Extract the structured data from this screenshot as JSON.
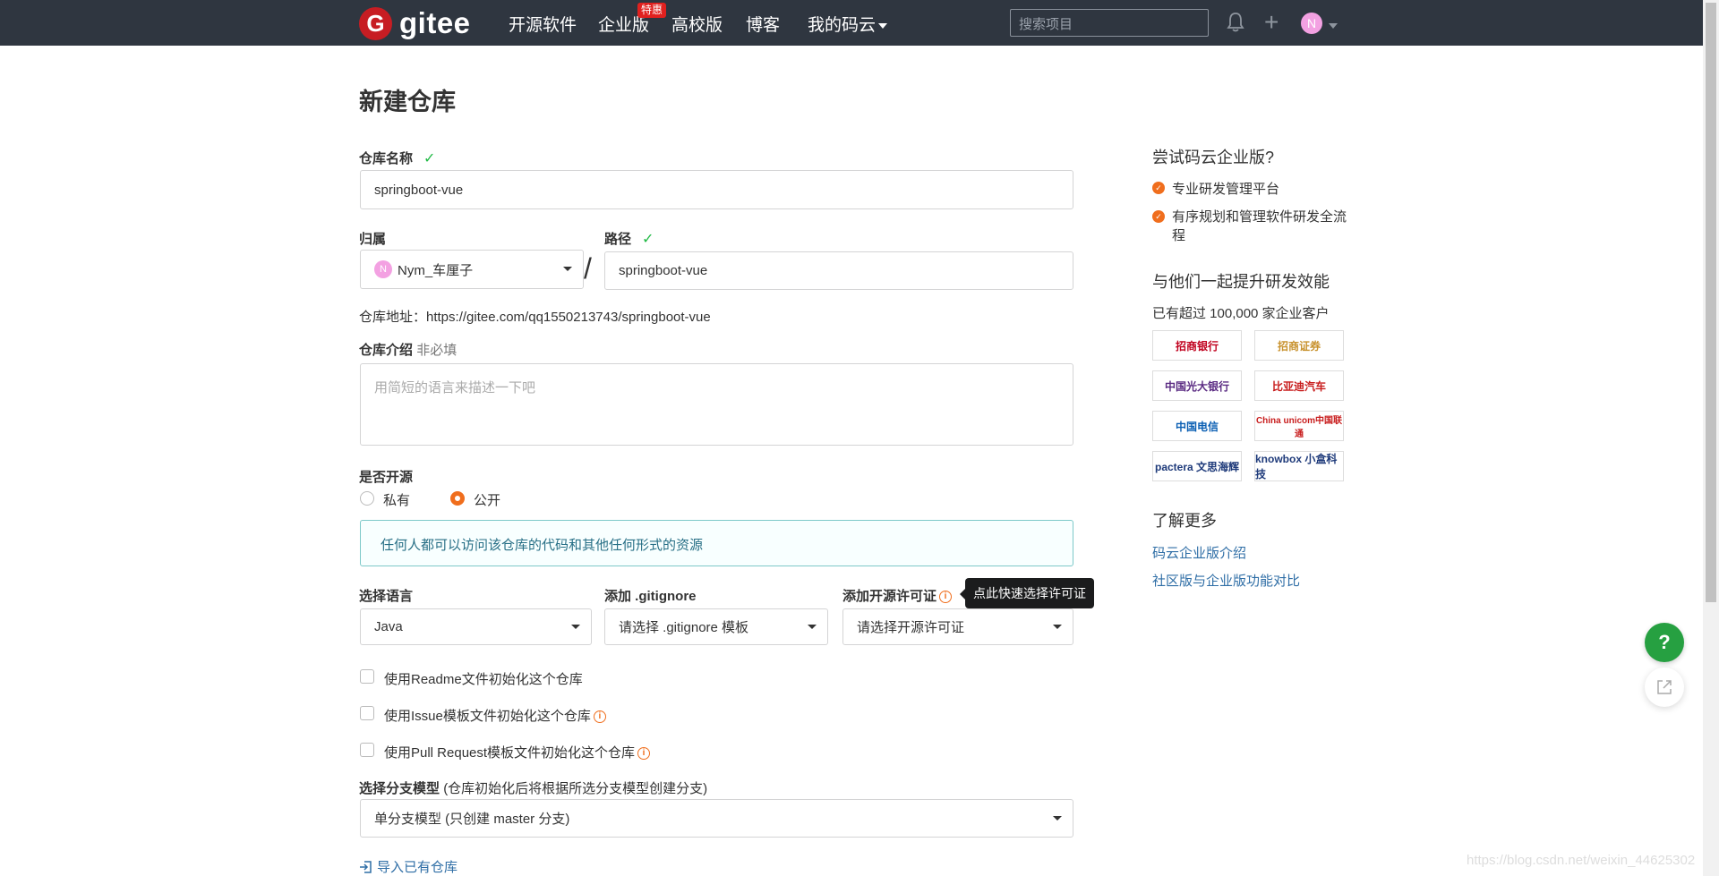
{
  "nav": {
    "logo_mark": "G",
    "logo_text": "gitee",
    "items": [
      "开源软件",
      "企业版",
      "高校版",
      "博客",
      "我的码云"
    ],
    "badge": "特惠",
    "search_placeholder": "搜索项目",
    "avatar": "N"
  },
  "page": {
    "title": "新建仓库"
  },
  "form": {
    "repo_name_label": "仓库名称",
    "repo_name_value": "springboot-vue",
    "owner_label": "归属",
    "owner_avatar": "N",
    "owner_value": "Nym_车厘子",
    "slash": "/",
    "path_label": "路径",
    "path_value": "springboot-vue",
    "repo_url": "仓库地址：https://gitee.com/qq1550213743/springboot-vue",
    "intro_label": "仓库介绍",
    "intro_optional": "非必填",
    "intro_placeholder": "用简短的语言来描述一下吧",
    "open_label": "是否开源",
    "private_label": "私有",
    "public_label": "公开",
    "public_info": "任何人都可以访问该仓库的代码和其他任何形式的资源",
    "language_label": "选择语言",
    "language_value": "Java",
    "gitignore_label": "添加 .gitignore",
    "gitignore_value": "请选择 .gitignore 模板",
    "license_label": "添加开源许可证",
    "license_value": "请选择开源许可证",
    "license_tooltip": "点此快速选择许可证",
    "info_icon": "i",
    "check_readme": "使用Readme文件初始化这个仓库",
    "check_issue": "使用Issue模板文件初始化这个仓库",
    "check_pr": "使用Pull Request模板文件初始化这个仓库",
    "branch_label": "选择分支模型",
    "branch_hint": "(仓库初始化后将根据所选分支模型创建分支)",
    "branch_value": "单分支模型 (只创建 master 分支)",
    "import_link": "导入已有仓库"
  },
  "sidebar": {
    "try_title": "尝试码云企业版?",
    "features": [
      "专业研发管理平台",
      "有序规划和管理软件研发全流程"
    ],
    "together_title": "与他们一起提升研发效能",
    "customers": "已有超过 100,000 家企业客户",
    "logos": [
      "招商银行",
      "招商证券",
      "中国光大银行",
      "比亚迪汽车",
      "中国电信",
      "China unicom中国联通",
      "pactera 文思海辉",
      "knowbox 小盒科技"
    ],
    "learn_title": "了解更多",
    "links": [
      "码云企业版介绍",
      "社区版与企业版功能对比"
    ]
  },
  "float": {
    "help": "?"
  },
  "watermark": "https://blog.csdn.net/weixin_44625302",
  "colors": {
    "topbar": "#2f3640",
    "accent": "#f06e1d",
    "success": "#21ba45",
    "help": "#26a041",
    "link": "#2f6ea6"
  }
}
